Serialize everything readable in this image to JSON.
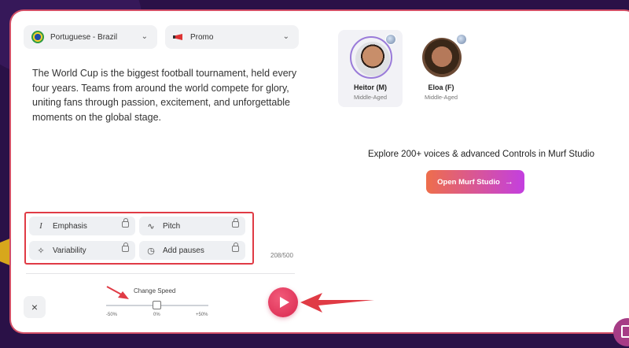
{
  "language": {
    "label": "Portuguese - Brazil",
    "icon": "brazil-flag-icon"
  },
  "style": {
    "label": "Promo",
    "icon": "megaphone-icon"
  },
  "script_text": "The World Cup is the biggest football tournament, held every four years. Teams from around the world compete for glory, uniting fans through passion, excitement, and unforgettable moments on the global stage.",
  "controls": [
    {
      "label": "Emphasis",
      "icon": "emphasis-icon"
    },
    {
      "label": "Pitch",
      "icon": "pitch-wave-icon"
    },
    {
      "label": "Variability",
      "icon": "sparkle-icon"
    },
    {
      "label": "Add pauses",
      "icon": "clock-icon"
    }
  ],
  "char_count": "208/500",
  "speed": {
    "label": "Change Speed",
    "min_label": "-50%",
    "mid_label": "0%",
    "max_label": "+50%",
    "value_percent": 0
  },
  "voices": [
    {
      "name": "Heitor (M)",
      "age": "Middle-Aged",
      "selected": true
    },
    {
      "name": "Eloa (F)",
      "age": "Middle-Aged",
      "selected": false
    }
  ],
  "explore_text": "Explore 200+ voices & advanced Controls in Murf Studio",
  "open_studio_label": "Open Murf Studio",
  "colors": {
    "accent_gradient_start": "#ee6e4b",
    "accent_gradient_end": "#c33fe0",
    "play_button": "#e23a5e",
    "annotation_red": "#e03b45",
    "background": "#2a1147"
  }
}
